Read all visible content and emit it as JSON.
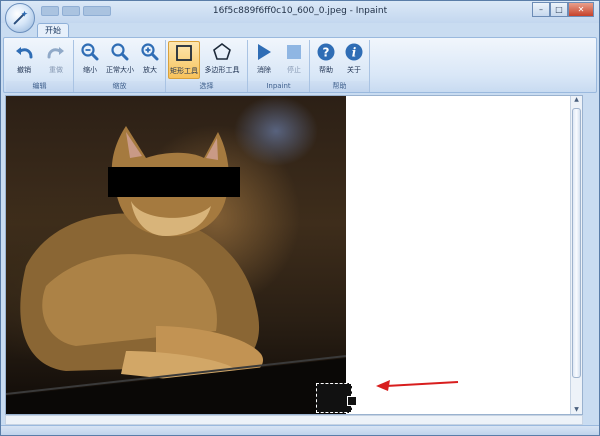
{
  "window": {
    "title": "16f5c889f6ff0c10_600_0.jpeg - Inpaint",
    "controls": {
      "minimize": "–",
      "maximize": "□",
      "close": "✕"
    }
  },
  "tabs": [
    {
      "label": "开始"
    }
  ],
  "ribbon": {
    "groups": {
      "edit": {
        "label": "编辑",
        "buttons": {
          "undo": "撤销",
          "redo": "重做"
        }
      },
      "zoom": {
        "label": "缩放",
        "buttons": {
          "zoom_out": "缩小",
          "actual_size": "正常大小",
          "zoom_in": "放大"
        }
      },
      "select": {
        "label": "选择",
        "buttons": {
          "rect_tool": "矩形工具",
          "polygon_tool": "多边形工具"
        }
      },
      "inpaint": {
        "label": "Inpaint",
        "buttons": {
          "erase": "消除",
          "stop": "停止"
        }
      },
      "help": {
        "label": "帮助",
        "buttons": {
          "help": "帮助",
          "about": "关于"
        }
      }
    }
  },
  "colors": {
    "accent": "#2f6db5",
    "active_tool": "#f7c25b",
    "arrow": "#d81e1e",
    "mask": "#000000"
  }
}
